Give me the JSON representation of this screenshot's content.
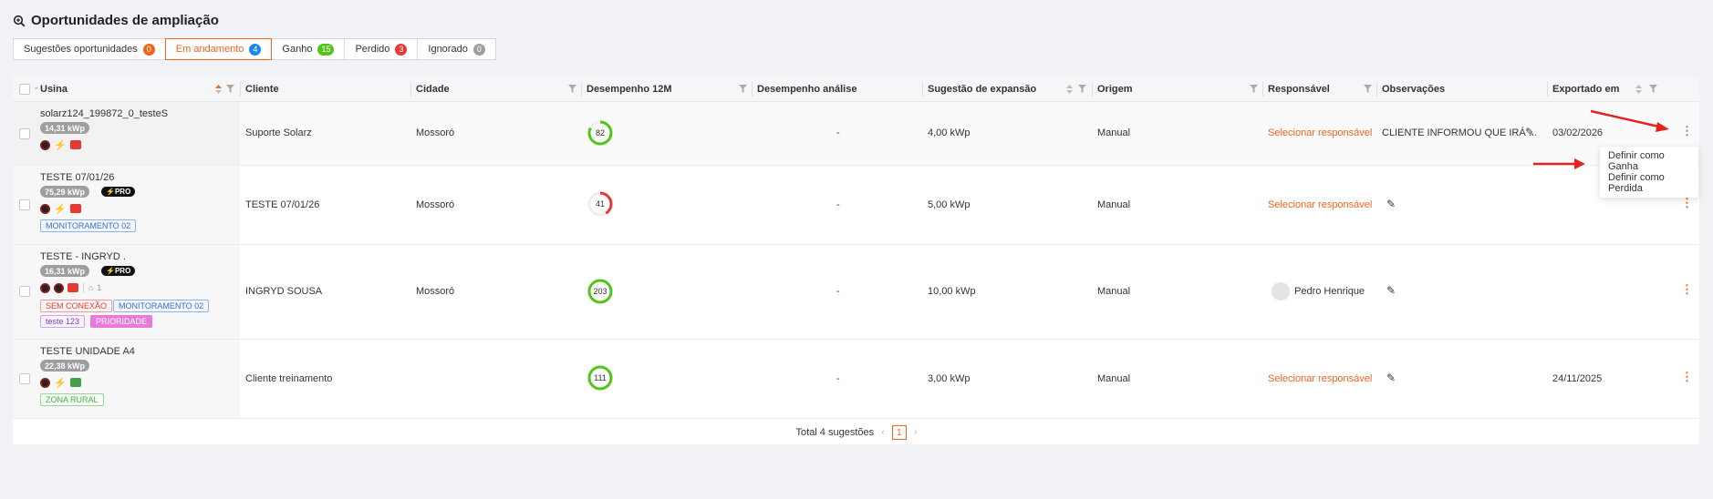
{
  "header": {
    "title": "Oportunidades de ampliação"
  },
  "tabs": [
    {
      "label": "Sugestões oportunidades",
      "count": "0",
      "color": "#f0641e"
    },
    {
      "label": "Em andamento",
      "count": "4",
      "color": "#1e88e5"
    },
    {
      "label": "Ganho",
      "count": "15",
      "color": "#52c41a"
    },
    {
      "label": "Perdido",
      "count": "3",
      "color": "#e53935"
    },
    {
      "label": "Ignorado",
      "count": "0",
      "color": "#9e9e9e"
    }
  ],
  "columns": {
    "usina": "Usina",
    "cliente": "Cliente",
    "cidade": "Cidade",
    "desempenho12m": "Desempenho 12M",
    "desempenho_analise": "Desempenho análise",
    "sugestao": "Sugestão de expansão",
    "origem": "Origem",
    "responsavel": "Responsável",
    "observacoes": "Observações",
    "exportado": "Exportado em"
  },
  "rows": [
    {
      "name": "solarz124_199872_0_testeS",
      "kwp": "14,31 kWp",
      "cliente": "Suporte Solarz",
      "cidade": "Mossoró",
      "desempenho": "82",
      "analise": "-",
      "sugestao": "4,00 kWp",
      "origem": "Manual",
      "responsavel": "Selecionar responsável",
      "observacoes": "CLIENTE INFORMOU QUE IRÁ ...",
      "exportado": "03/02/2026"
    },
    {
      "name": "TESTE 07/01/26",
      "kwp": "75,29 kWp",
      "pro": "PRO",
      "tags": [
        "MONITORAMENTO 02"
      ],
      "cliente": "TESTE 07/01/26",
      "cidade": "Mossoró",
      "desempenho": "41",
      "analise": "-",
      "sugestao": "5,00 kWp",
      "origem": "Manual",
      "responsavel": "Selecionar responsável",
      "exportado": ""
    },
    {
      "name": "TESTE - INGRYD .",
      "kwp": "16,31 kWp",
      "pro": "PRO",
      "inverter_count": "1",
      "tags": [
        "SEM CONEXÃO",
        "MONITORAMENTO 02",
        "teste 123",
        "PRIORIDADE"
      ],
      "cliente": "INGRYD SOUSA",
      "cidade": "Mossoró",
      "desempenho": "203",
      "analise": "-",
      "sugestao": "10,00 kWp",
      "origem": "Manual",
      "responsavel": "Pedro Henrique",
      "exportado": ""
    },
    {
      "name": "TESTE UNIDADE A4",
      "kwp": "22,38 kWp",
      "tags": [
        "ZONA RURAL"
      ],
      "cliente": "Cliente treinamento",
      "cidade": "",
      "desempenho": "111",
      "analise": "-",
      "sugestao": "3,00 kWp",
      "origem": "Manual",
      "responsavel": "Selecionar responsável",
      "exportado": "24/11/2025"
    }
  ],
  "context_menu": {
    "items": [
      "Definir como Ganha",
      "Definir como Perdida"
    ]
  },
  "pagination": {
    "total": "Total 4 sugestões",
    "page": "1"
  },
  "performance_levels": [
    0.82,
    0.41,
    1.0,
    1.0
  ],
  "performance_colors": [
    "#52c41a",
    "#e53935",
    "#52c41a",
    "#52c41a"
  ]
}
